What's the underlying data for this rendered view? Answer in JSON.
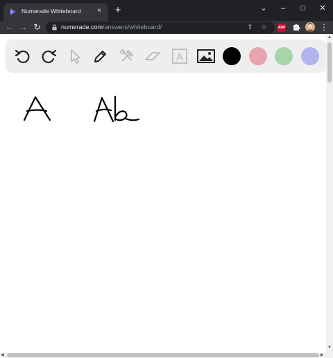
{
  "browser": {
    "tab_title": "Numerade Whiteboard",
    "tab_close": "×",
    "new_tab": "+",
    "window_controls": {
      "minimize": "–",
      "maximize": "□",
      "close": "✕",
      "expand": "⌄"
    },
    "url_host": "numerade.com",
    "url_path": "/answers/whiteboard/",
    "extension_abp": "ABP"
  },
  "whiteboard": {
    "tools": [
      {
        "name": "undo-icon"
      },
      {
        "name": "redo-icon"
      },
      {
        "name": "select-cursor-icon"
      },
      {
        "name": "pen-icon"
      },
      {
        "name": "tools-icon"
      },
      {
        "name": "eraser-icon"
      },
      {
        "name": "text-tool-icon"
      },
      {
        "name": "image-icon"
      }
    ],
    "colors": [
      "#000000",
      "#e8a4ae",
      "#a8d5a8",
      "#b3b3ee"
    ],
    "text_tool_glyph": "A",
    "canvas_strokes": [
      "A",
      "Ab"
    ]
  }
}
